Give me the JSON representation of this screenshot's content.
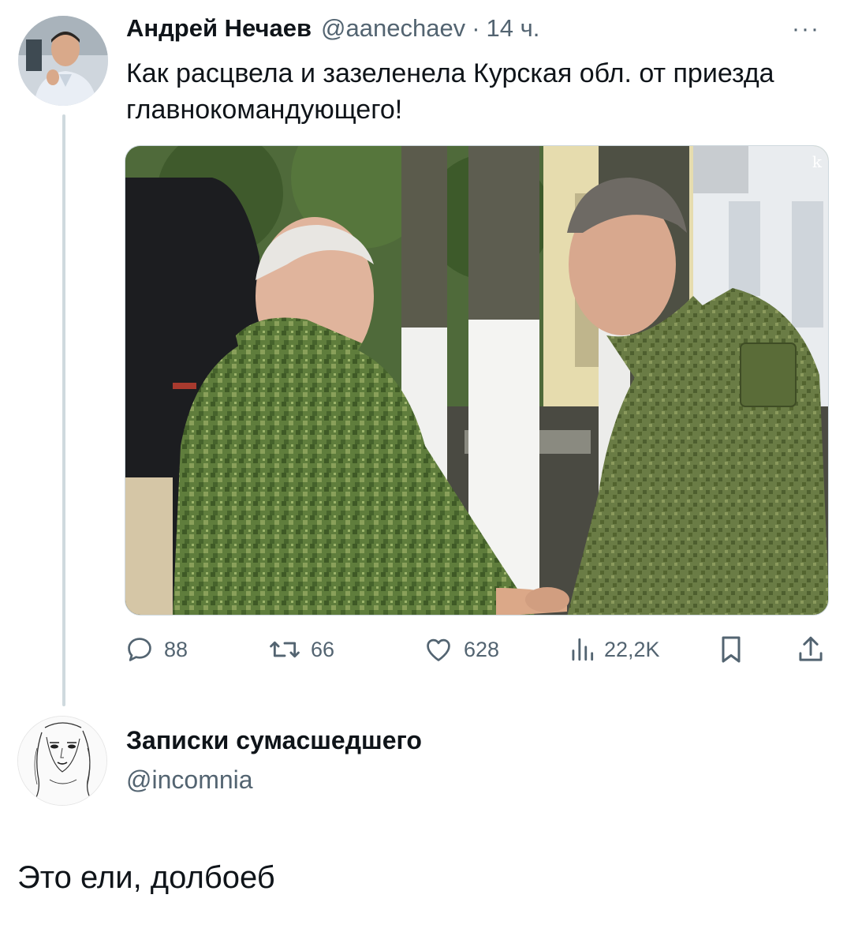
{
  "tweet": {
    "author_name": "Андрей Нечаев",
    "handle": "@aanechaev",
    "separator": "·",
    "time": "14 ч.",
    "more": "···",
    "text": "Как расцвела и зазеленела Курская обл. от приезда главнокомандующего!",
    "photo": {
      "watermark": "k"
    },
    "stats": {
      "replies": "88",
      "retweets": "66",
      "likes": "628",
      "views": "22,2K"
    }
  },
  "reply": {
    "author_name": "Записки сумасшедшего",
    "handle": "@incomnia",
    "text": "Это ели, долбоеб"
  },
  "colors": {
    "text_primary": "#0f1419",
    "text_secondary": "#536471",
    "thread_line": "#cfd9de"
  },
  "icons": [
    "reply-icon",
    "retweet-icon",
    "like-icon",
    "views-icon",
    "bookmark-icon",
    "share-icon",
    "more-icon"
  ]
}
